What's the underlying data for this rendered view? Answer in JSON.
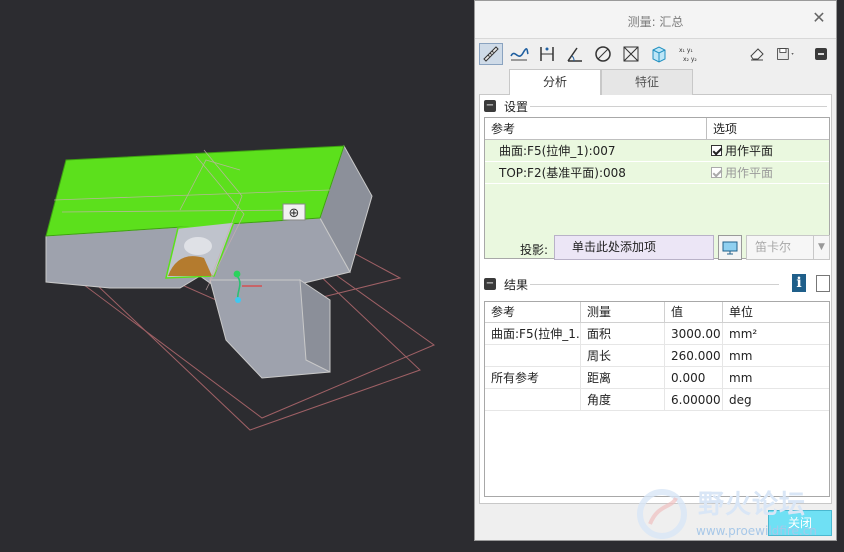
{
  "dialog": {
    "title": "测量: 汇总",
    "close_glyph": "✕",
    "tabs": [
      {
        "label": "分析",
        "active": true
      },
      {
        "label": "特征",
        "active": false
      }
    ],
    "toolbar": {
      "tools": [
        "length-icon",
        "curve-icon",
        "distance-icon",
        "angle-icon",
        "diameter-icon",
        "transform-icon",
        "volume-icon",
        "xyz-icon"
      ],
      "right_tools": [
        "eraser-icon",
        "save-icon",
        "collapse-icon"
      ]
    },
    "settings": {
      "title": "设置",
      "columns": [
        "参考",
        "选项"
      ],
      "rows": [
        {
          "ref": "曲面:F5(拉伸_1):007",
          "option": "用作平面",
          "checked": true,
          "disabled": false
        },
        {
          "ref": "TOP:F2(基准平面):008",
          "option": "用作平面",
          "checked": true,
          "disabled": true
        }
      ],
      "projection_label": "投影:",
      "projection_placeholder": "单击此处添加项",
      "coordinate_select": "笛卡尔"
    },
    "results": {
      "title": "结果",
      "columns": [
        "参考",
        "测量",
        "值",
        "单位"
      ],
      "rows": [
        {
          "ref": "曲面:F5(拉伸_1...",
          "measure": "面积",
          "value": "3000.00",
          "unit": "mm²"
        },
        {
          "ref": "",
          "measure": "周长",
          "value": "260.000",
          "unit": "mm"
        },
        {
          "ref": "所有参考",
          "measure": "距离",
          "value": "0.000",
          "unit": "mm"
        },
        {
          "ref": "",
          "measure": "角度",
          "value": "6.00000",
          "unit": "deg"
        }
      ]
    },
    "close_button": "关闭"
  },
  "watermark": {
    "title": "野火论坛",
    "url": "www.proewildfire.cn"
  },
  "colors": {
    "viewport_bg": "#2c2c30",
    "surface_green": "#5ce01c",
    "model_gray": "#9ea2ad",
    "selected_row_bg": "#eaf8df",
    "close_button": "#6fe0f4"
  }
}
